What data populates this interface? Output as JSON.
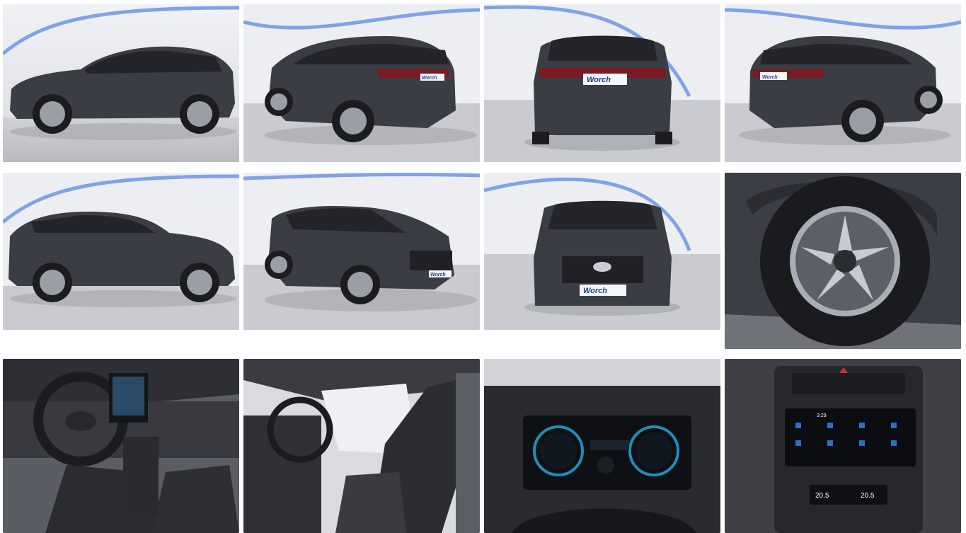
{
  "gallery": {
    "plate_text": "Worch",
    "screen_clock": "3:29",
    "climate_left": "20.5",
    "climate_right": "20.5",
    "photos": [
      {
        "name": "photo-side-left",
        "view": "side-left"
      },
      {
        "name": "photo-rear-three-quarter-left",
        "view": "rear-three-quarter-left"
      },
      {
        "name": "photo-rear",
        "view": "rear"
      },
      {
        "name": "photo-rear-three-quarter-right",
        "view": "rear-three-quarter-right"
      },
      {
        "name": "photo-side-right",
        "view": "side-right"
      },
      {
        "name": "photo-front-three-quarter",
        "view": "front-three-quarter"
      },
      {
        "name": "photo-front",
        "view": "front"
      },
      {
        "name": "photo-wheel-detail",
        "view": "wheel"
      },
      {
        "name": "photo-interior-cockpit",
        "view": "interior-cockpit"
      },
      {
        "name": "photo-interior-front-seats",
        "view": "interior-seats"
      },
      {
        "name": "photo-instrument-cluster",
        "view": "instrument-cluster"
      },
      {
        "name": "photo-infotainment",
        "view": "infotainment"
      }
    ],
    "colors": {
      "car_body": "#3a3d44",
      "studio_wall": "#eceef2",
      "studio_floor": "#c9cbd0",
      "led_strip": "#7fa3e8"
    }
  }
}
